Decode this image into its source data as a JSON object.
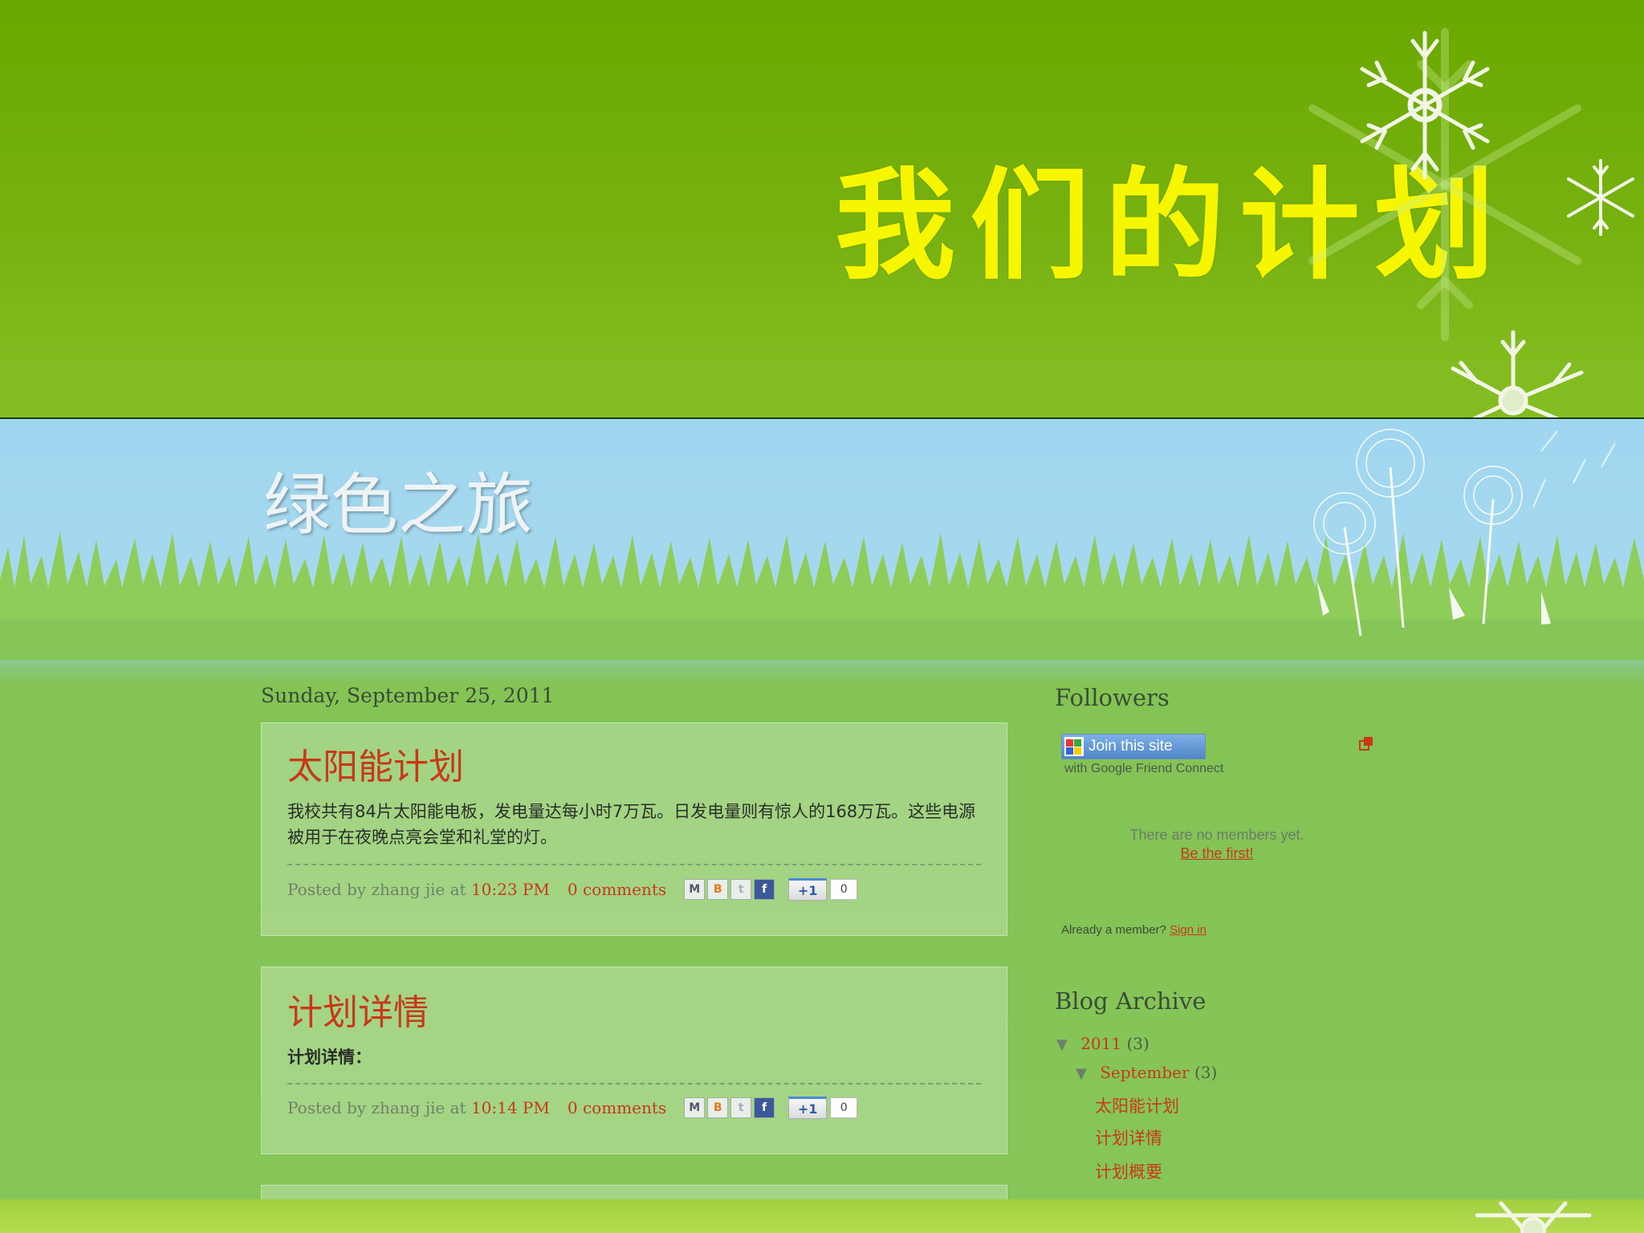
{
  "slide": {
    "title": "我们的计划",
    "title_color": "#f6f600",
    "background_color": "#78b212"
  },
  "blog": {
    "title": "绿色之旅",
    "date_header": "Sunday, September 25, 2011",
    "link_color": "#c8391a",
    "posts": [
      {
        "title": "太阳能计划",
        "body": "我校共有84片太阳能电板，发电量达每小时7万瓦。日发电量则有惊人的168万瓦。这些电源被用于在夜晚点亮会堂和礼堂的灯。",
        "posted_by": "Posted by zhang jie at",
        "time": "10:23 PM",
        "comments": "0 comments",
        "plusone_label": "+1",
        "plusone_count": "0"
      },
      {
        "title": "计划详情",
        "body": "计划详情：",
        "posted_by": "Posted by zhang jie at",
        "time": "10:14 PM",
        "comments": "0 comments",
        "plusone_label": "+1",
        "plusone_count": "0"
      }
    ],
    "share_icons": [
      "email-icon",
      "blogger-icon",
      "twitter-icon",
      "facebook-icon"
    ]
  },
  "sidebar": {
    "followers": {
      "title": "Followers",
      "join_button": "Join this site",
      "gfc_caption": "with Google Friend Connect",
      "no_members": "There are no members yet.",
      "be_first": "Be the first!",
      "already_member": "Already a member?",
      "sign_in": "Sign in"
    },
    "archive": {
      "title": "Blog Archive",
      "year": "2011",
      "year_count": "(3)",
      "month": "September",
      "month_count": "(3)",
      "posts": [
        "太阳能计划",
        "计划详情",
        "计划概要"
      ]
    }
  }
}
